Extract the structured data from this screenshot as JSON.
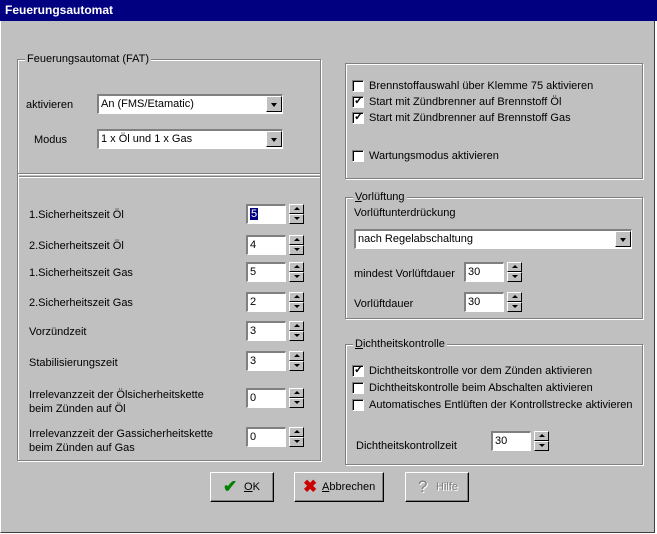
{
  "window": {
    "title": "Feuerungsautomat"
  },
  "fat": {
    "title": "Feuerungsautomat (FAT)",
    "aktivieren_label": "aktivieren",
    "aktivieren_value": "An (FMS/Etamatic)",
    "modus_label": "Modus",
    "modus_value": "1 x Öl und 1 x Gas"
  },
  "options": [
    {
      "label": "Brennstoffauswahl über Klemme 75 aktivieren",
      "checked": false
    },
    {
      "label": "Start mit Zündbrenner auf Brennstoff Öl",
      "checked": true
    },
    {
      "label": "Start mit Zündbrenner auf Brennstoff Gas",
      "checked": true
    },
    {
      "label": "Wartungsmodus aktivieren",
      "checked": false
    }
  ],
  "times": [
    {
      "label": "1.Sicherheitszeit Öl",
      "value": "5"
    },
    {
      "label": "2.Sicherheitszeit Öl",
      "value": "4"
    },
    {
      "label": "1.Sicherheitszeit Gas",
      "value": "5"
    },
    {
      "label": "2.Sicherheitszeit Gas",
      "value": "2"
    },
    {
      "label": "Vorzündzeit",
      "value": "3"
    },
    {
      "label": "Stabilisierungszeit",
      "value": "3"
    },
    {
      "label": "Irrelevanzzeit der Ölsicherheitskette",
      "label2": "beim Zünden auf Öl",
      "value": "0"
    },
    {
      "label": "Irrelevanzzeit der Gassicherheitskette",
      "label2": "beim Zünden auf Gas",
      "value": "0"
    }
  ],
  "vorlueftung": {
    "title_first": "V",
    "title_rest": "orlüftung",
    "unterdrueckung_label": "Vorlüftunterdrückung",
    "unterdrueckung_value": "nach Regelabschaltung",
    "mindest_label": "mindest Vorlüftdauer",
    "mindest_value": "30",
    "dauer_label": "Vorlüftdauer",
    "dauer_value": "30"
  },
  "dichtheit": {
    "title_first": "D",
    "title_rest": "ichtheitskontrolle",
    "checks": [
      {
        "label": "Dichtheitskontrolle vor dem Zünden aktivieren",
        "checked": true
      },
      {
        "label": "Dichtheitskontrolle beim Abschalten aktivieren",
        "checked": false
      },
      {
        "label": "Automatisches Entlüften der Kontrollstrecke aktivieren",
        "checked": false
      }
    ],
    "zeit_label": "Dichtheitskontrollzeit",
    "zeit_value": "30"
  },
  "buttons": {
    "ok_first": "O",
    "ok_rest": "K",
    "cancel_first": "A",
    "cancel_rest": "bbrechen",
    "help": "Hilfe"
  },
  "colors": {
    "titlebar": "#000080",
    "face": "#c0c0c0",
    "ok_icon": "#008000",
    "cancel_icon": "#cc0000"
  },
  "icons": {
    "ok": "checkmark-icon",
    "cancel": "x-icon",
    "help": "question-mark-icon"
  }
}
